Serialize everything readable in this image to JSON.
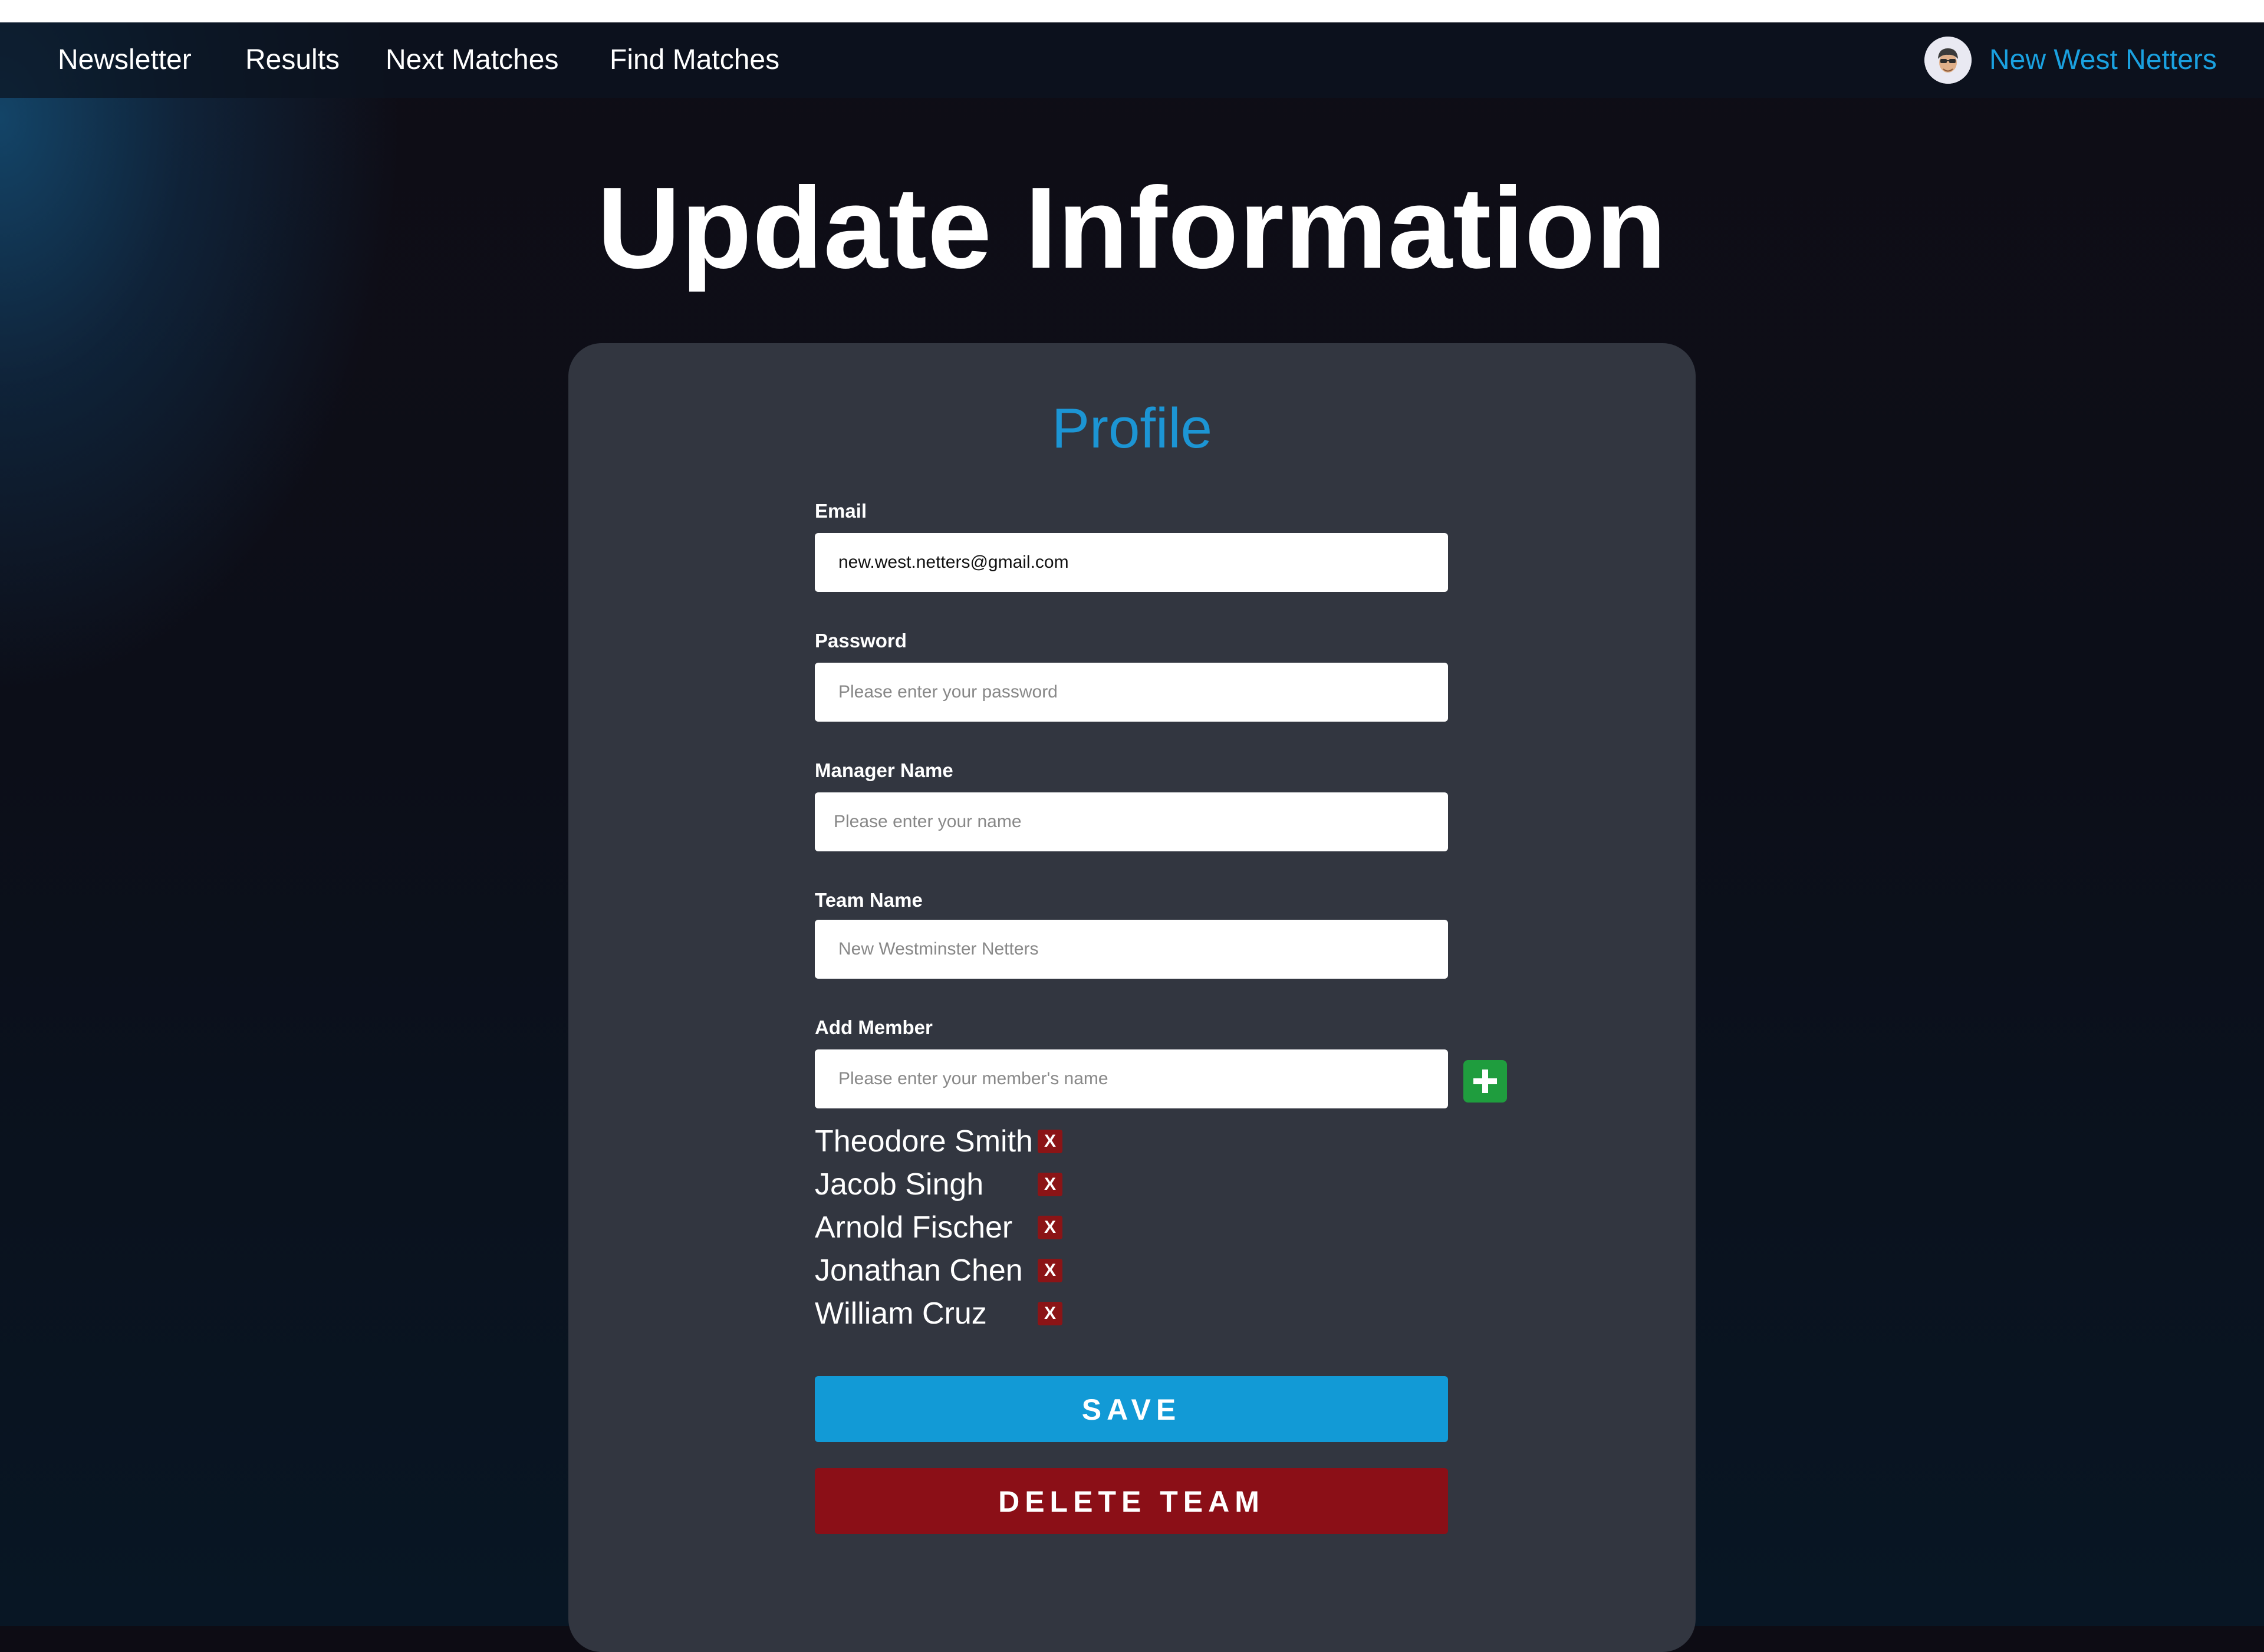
{
  "nav": {
    "links": [
      "Newsletter",
      "Results",
      "Next Matches",
      "Find Matches"
    ],
    "team_name": "New West Netters",
    "avatar_icon": "user-avatar-icon"
  },
  "page": {
    "title": "Update Information"
  },
  "profile": {
    "heading": "Profile",
    "email": {
      "label": "Email",
      "value": "new.west.netters@gmail.com"
    },
    "password": {
      "label": "Password",
      "placeholder": "Please enter your password"
    },
    "manager_name": {
      "label": "Manager Name",
      "placeholder": "Please enter your name"
    },
    "team_name": {
      "label": "Team Name",
      "placeholder": "New Westminster Netters"
    },
    "add_member": {
      "label": "Add Member",
      "placeholder": "Please enter your member's name",
      "add_icon": "plus-icon"
    },
    "members": [
      "Theodore Smith",
      "Jacob Singh",
      "Arnold Fischer",
      "Jonathan Chen",
      "William Cruz"
    ],
    "remove_label": "X",
    "save_label": "SAVE",
    "delete_label": "DELETE TEAM"
  },
  "colors": {
    "accent": "#1aa1e0",
    "card": "#323640",
    "save": "#129ad6",
    "delete": "#8b0f17",
    "add": "#1f9d3e"
  }
}
